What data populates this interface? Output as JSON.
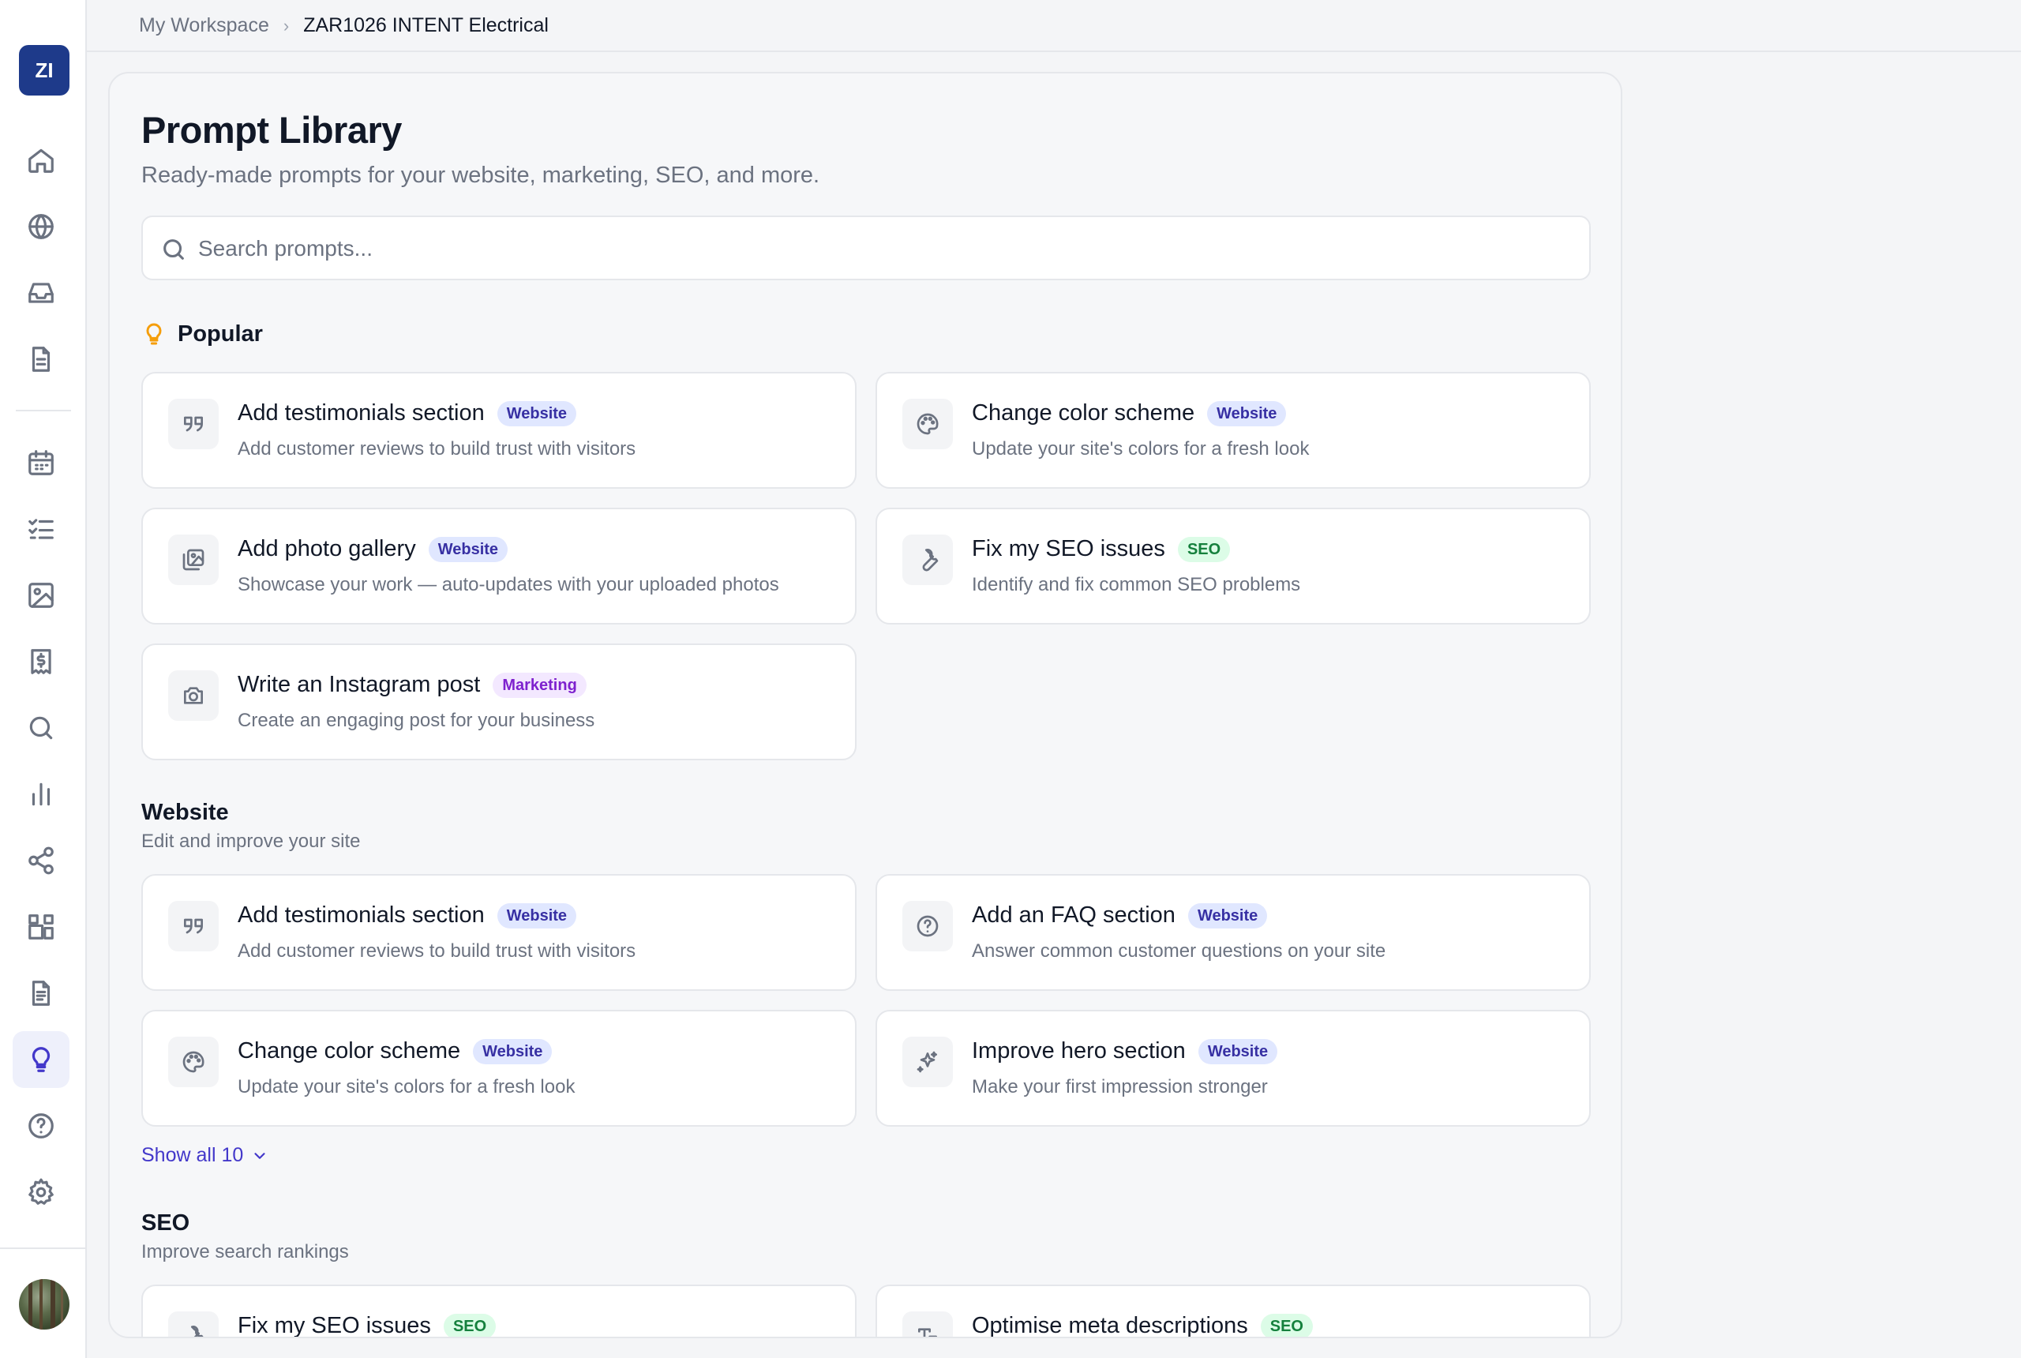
{
  "sidebar": {
    "workspace_initials": "ZI",
    "nav_top": [
      "home-icon",
      "globe-icon",
      "inbox-icon",
      "document-icon"
    ],
    "nav_main": [
      "calendar-icon",
      "checklist-icon",
      "image-icon",
      "invoice-icon",
      "search-icon",
      "bar-chart-icon",
      "share-icon",
      "apps-icon",
      "page-icon",
      "lightbulb-icon",
      "help-icon",
      "settings-icon"
    ],
    "active_item": "lightbulb-icon"
  },
  "breadcrumb": {
    "root": "My Workspace",
    "separator": "›",
    "current": "ZAR1026 INTENT Electrical"
  },
  "page": {
    "title": "Prompt Library",
    "subtitle": "Ready-made prompts for your website, marketing, SEO, and more."
  },
  "search": {
    "placeholder": "Search prompts..."
  },
  "popular": {
    "label": "Popular",
    "cards": [
      {
        "icon": "quote-icon",
        "title": "Add testimonials section",
        "badge": "Website",
        "badge_type": "website",
        "desc": "Add customer reviews to build trust with visitors"
      },
      {
        "icon": "palette-icon",
        "title": "Change color scheme",
        "badge": "Website",
        "badge_type": "website",
        "desc": "Update your site's colors for a fresh look"
      },
      {
        "icon": "gallery-icon",
        "title": "Add photo gallery",
        "badge": "Website",
        "badge_type": "website",
        "desc": "Showcase your work — auto-updates with your uploaded photos"
      },
      {
        "icon": "wrench-icon",
        "title": "Fix my SEO issues",
        "badge": "SEO",
        "badge_type": "seo",
        "desc": "Identify and fix common SEO problems"
      },
      {
        "icon": "camera-icon",
        "title": "Write an Instagram post",
        "badge": "Marketing",
        "badge_type": "marketing",
        "desc": "Create an engaging post for your business"
      }
    ]
  },
  "website": {
    "title": "Website",
    "subtitle": "Edit and improve your site",
    "cards": [
      {
        "icon": "quote-icon",
        "title": "Add testimonials section",
        "badge": "Website",
        "badge_type": "website",
        "desc": "Add customer reviews to build trust with visitors"
      },
      {
        "icon": "help-circle-icon",
        "title": "Add an FAQ section",
        "badge": "Website",
        "badge_type": "website",
        "desc": "Answer common customer questions on your site"
      },
      {
        "icon": "palette-icon",
        "title": "Change color scheme",
        "badge": "Website",
        "badge_type": "website",
        "desc": "Update your site's colors for a fresh look"
      },
      {
        "icon": "sparkles-icon",
        "title": "Improve hero section",
        "badge": "Website",
        "badge_type": "website",
        "desc": "Make your first impression stronger"
      }
    ],
    "show_all_label": "Show all 10"
  },
  "seo": {
    "title": "SEO",
    "subtitle": "Improve search rankings",
    "cards": [
      {
        "icon": "wrench-icon",
        "title": "Fix my SEO issues",
        "badge": "SEO",
        "badge_type": "seo",
        "desc": ""
      },
      {
        "icon": "text-icon",
        "title": "Optimise meta descriptions",
        "badge": "SEO",
        "badge_type": "seo",
        "desc": ""
      }
    ]
  }
}
